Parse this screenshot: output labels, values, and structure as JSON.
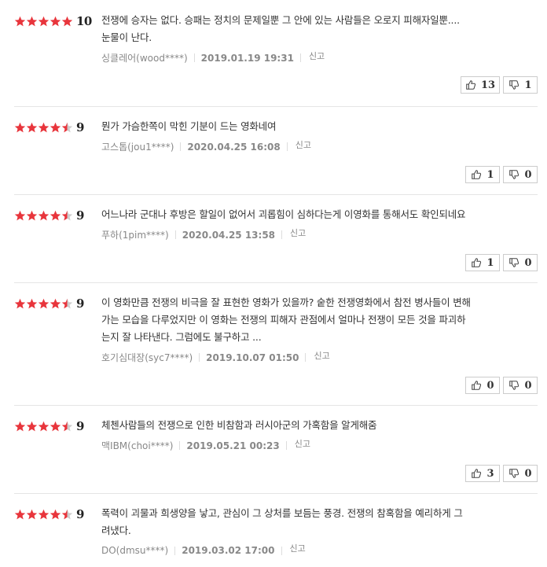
{
  "colors": {
    "star_filled": "#e8353c",
    "star_empty": "#cccccc"
  },
  "reviews": [
    {
      "stars": 5,
      "score": "10",
      "text_lines": [
        "전쟁에 승자는 없다. 승패는 정치의 문제일뿐 그 안에 있는 사람들은 오로지 피해자일뿐....",
        "눈물이 난다."
      ],
      "author": "싱클레어(wood****)",
      "date": "2019.01.19 19:31",
      "report": "신고",
      "likes": "13",
      "dislikes": "1"
    },
    {
      "stars": 4.5,
      "score": "9",
      "text_lines": [
        "뭔가 가슴한쪽이 막힌 기분이 드는 영화네여"
      ],
      "author": "고스톱(jou1****)",
      "date": "2020.04.25 16:08",
      "report": "신고",
      "likes": "1",
      "dislikes": "0"
    },
    {
      "stars": 4.5,
      "score": "9",
      "text_lines": [
        "어느나라 군대나 후방은 할일이 없어서 괴롭힘이 심하다는게 이영화를 통해서도 확인되네요"
      ],
      "author": "푸하(1pim****)",
      "date": "2020.04.25 13:58",
      "report": "신고",
      "likes": "1",
      "dislikes": "0"
    },
    {
      "stars": 4.5,
      "score": "9",
      "text_lines": [
        "이 영화만큼 전쟁의 비극을 잘 표현한 영화가 있을까? 숱한 전쟁영화에서 참전 병사들이 변해",
        "가는 모습을 다루었지만 이 영화는 전쟁의 피해자 관점에서 얼마나 전쟁이 모든 것을 파괴하",
        "는지 잘 나타낸다. 그럼에도 불구하고 ..."
      ],
      "author": "호기심대장(syc7****)",
      "date": "2019.10.07 01:50",
      "report": "신고",
      "likes": "0",
      "dislikes": "0"
    },
    {
      "stars": 4.5,
      "score": "9",
      "text_lines": [
        "체첸사람들의 전쟁으로 인한 비참함과 러시아군의 가혹함을 알게해줌"
      ],
      "author": "맥IBM(choi****)",
      "date": "2019.05.21 00:23",
      "report": "신고",
      "likes": "3",
      "dislikes": "0"
    },
    {
      "stars": 4.5,
      "score": "9",
      "text_lines": [
        "폭력이 괴물과 희생양을 낳고, 관심이 그 상처를 보듬는 풍경. 전쟁의 참혹함을 예리하게 그",
        "려냈다."
      ],
      "author": "DO(dmsu****)",
      "date": "2019.03.02 17:00",
      "report": "신고",
      "likes": "",
      "dislikes": ""
    }
  ]
}
